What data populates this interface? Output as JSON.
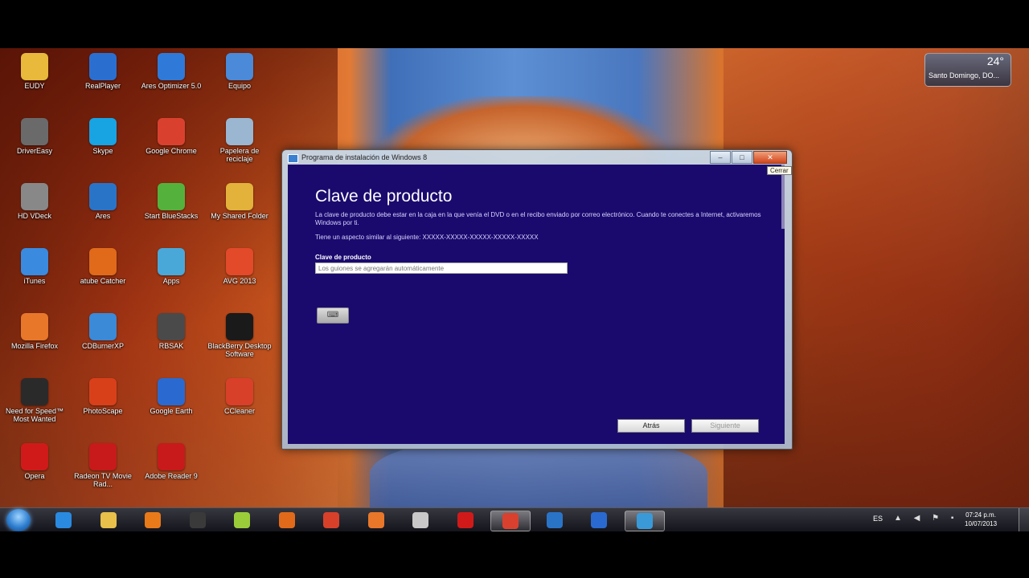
{
  "desktop": {
    "icons": [
      {
        "label": "EUDY",
        "icon": "folder-icon",
        "color": "#e8b93a"
      },
      {
        "label": "RealPlayer",
        "icon": "realplayer-icon",
        "color": "#2a6fd0"
      },
      {
        "label": "Ares Optimizer 5.0",
        "icon": "ares-optimizer-icon",
        "color": "#2f7ad8"
      },
      {
        "label": "Equipo",
        "icon": "computer-icon",
        "color": "#4a8ad8"
      },
      {
        "label": "DriverEasy",
        "icon": "drivereasy-icon",
        "color": "#6a6a6a"
      },
      {
        "label": "Skype",
        "icon": "skype-icon",
        "color": "#18a3e3"
      },
      {
        "label": "Google Chrome",
        "icon": "chrome-icon",
        "color": "#d9412e"
      },
      {
        "label": "Papelera de reciclaje",
        "icon": "recycle-bin-icon",
        "color": "#9ab6d0"
      },
      {
        "label": "HD VDeck",
        "icon": "hdvdeck-icon",
        "color": "#888888"
      },
      {
        "label": "Ares",
        "icon": "ares-icon",
        "color": "#2a74c8"
      },
      {
        "label": "Start BlueStacks",
        "icon": "bluestacks-icon",
        "color": "#54b23c"
      },
      {
        "label": "My Shared Folder",
        "icon": "shared-folder-icon",
        "color": "#e3b23a"
      },
      {
        "label": "iTunes",
        "icon": "itunes-icon",
        "color": "#3a8ae0"
      },
      {
        "label": "atube Catcher",
        "icon": "atube-catcher-icon",
        "color": "#e06a1a"
      },
      {
        "label": "Apps",
        "icon": "apps-icon",
        "color": "#4aa8d8"
      },
      {
        "label": "AVG 2013",
        "icon": "avg-icon",
        "color": "#e24a2a"
      },
      {
        "label": "Mozilla Firefox",
        "icon": "firefox-icon",
        "color": "#e8772a"
      },
      {
        "label": "CDBurnerXP",
        "icon": "cdburnerxp-icon",
        "color": "#3a8ad8"
      },
      {
        "label": "RBSAK",
        "icon": "rbsak-icon",
        "color": "#4a4a4a"
      },
      {
        "label": "BlackBerry Desktop Software",
        "icon": "blackberry-icon",
        "color": "#1a1a1a"
      },
      {
        "label": "Need for Speed™ Most Wanted",
        "icon": "nfs-icon",
        "color": "#2a2a2a"
      },
      {
        "label": "PhotoScape",
        "icon": "photoscape-icon",
        "color": "#d8401a"
      },
      {
        "label": "Google Earth",
        "icon": "google-earth-icon",
        "color": "#2a6ad0"
      },
      {
        "label": "CCleaner",
        "icon": "ccleaner-icon",
        "color": "#d8402a"
      },
      {
        "label": "Opera",
        "icon": "opera-icon",
        "color": "#d01a1a"
      },
      {
        "label": "Radeon TV Movie Rad...",
        "icon": "radeon-icon",
        "color": "#c81a1a"
      },
      {
        "label": "Adobe Reader 9",
        "icon": "adobe-reader-icon",
        "color": "#c81a1a"
      }
    ],
    "weather": {
      "temp": "24°",
      "location": "Santo Domingo, DO..."
    }
  },
  "window": {
    "title": "Programa de instalación de Windows 8",
    "close_tooltip": "Cerrar",
    "minimize": "–",
    "maximize": "□",
    "close": "✕",
    "heading": "Clave de producto",
    "description": "La clave de producto debe estar en la caja en la que venía el DVD o en el recibo enviado por correo electrónico. Cuando te conectes a Internet, activaremos Windows por ti.",
    "similar": "Tiene un aspecto similar al siguiente: XXXXX-XXXXX-XXXXX-XXXXX-XXXXX",
    "field_label": "Clave de producto",
    "field_placeholder": "Los guiones se agregarán automáticamente",
    "keyboard_glyph": "⌨",
    "back_label": "Atrás",
    "next_label": "Siguiente"
  },
  "taskbar": {
    "items": [
      {
        "icon": "internet-explorer-icon",
        "color": "#2a8ae0",
        "active": false
      },
      {
        "icon": "explorer-folder-icon",
        "color": "#e8c04a",
        "active": false
      },
      {
        "icon": "media-player-icon",
        "color": "#e87a1a",
        "active": false
      },
      {
        "icon": "tool-icon",
        "color": "#3a3a3a",
        "active": false
      },
      {
        "icon": "notes-icon",
        "color": "#9acc3a",
        "active": false
      },
      {
        "icon": "atube-catcher-icon",
        "color": "#e06a1a",
        "active": false
      },
      {
        "icon": "ccleaner-icon",
        "color": "#d8402a",
        "active": false
      },
      {
        "icon": "firefox-icon",
        "color": "#e8772a",
        "active": false
      },
      {
        "icon": "sharing-icon",
        "color": "#c8c8c8",
        "active": false
      },
      {
        "icon": "opera-icon",
        "color": "#d01a1a",
        "active": false
      },
      {
        "icon": "chrome-icon",
        "color": "#d9412e",
        "active": true
      },
      {
        "icon": "ares-icon",
        "color": "#2a74c8",
        "active": false
      },
      {
        "icon": "speed-icon",
        "color": "#2a6ad0",
        "active": false
      },
      {
        "icon": "installer-icon",
        "color": "#3a9ad8",
        "active": true
      }
    ],
    "language": "ES",
    "time": "07:24 p.m.",
    "date": "10/07/2013"
  }
}
